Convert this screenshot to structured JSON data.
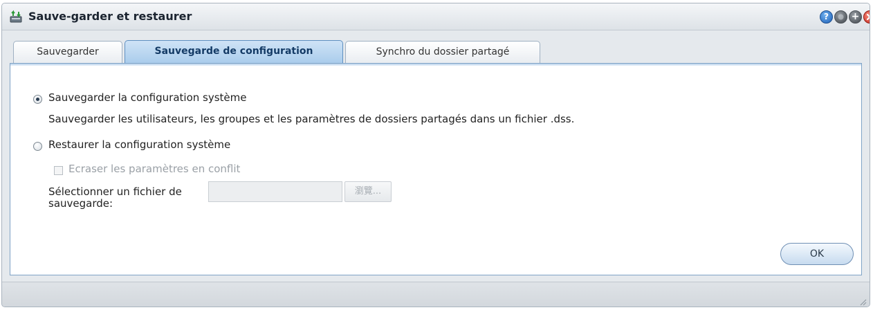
{
  "window": {
    "title": "Sauve-garder et restaurer",
    "controls": {
      "help": "?",
      "maximize": "+"
    }
  },
  "tabs": [
    {
      "label": "Sauvegarder",
      "active": false
    },
    {
      "label": "Sauvegarde de configuration",
      "active": true
    },
    {
      "label": "Synchro du dossier partagé",
      "active": false
    }
  ],
  "content": {
    "backup_option": {
      "label": "Sauvegarder la configuration système",
      "description": "Sauvegarder les utilisateurs, les groupes et les paramètres de dossiers partagés dans un fichier .dss.",
      "checked": true
    },
    "restore_option": {
      "label": "Restaurer la configuration système",
      "checked": false
    },
    "overwrite_checkbox": {
      "label": "Ecraser les paramètres en conflit",
      "checked": false
    },
    "file_select": {
      "label_line1": "Sélectionner un fichier de",
      "label_line2": "sauvegarde:",
      "value": "",
      "browse_label": "瀏覽..."
    },
    "ok_label": "OK"
  },
  "colors": {
    "accent": "#5e8fc0",
    "active_tab": "#a9ccec",
    "close": "#c8281e",
    "help": "#1d5fb5"
  }
}
